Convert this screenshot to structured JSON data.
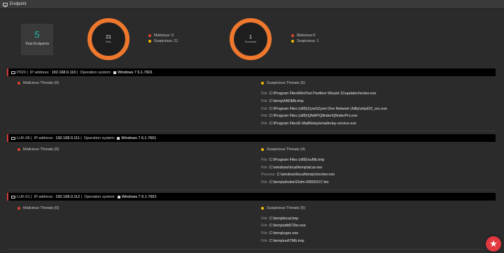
{
  "window": {
    "title": "Endpoint"
  },
  "summary": {
    "total_count": "5",
    "total_label": "Total Endpoints",
    "files": {
      "count": "21",
      "label": "Files",
      "malicious": "Malicious: 0",
      "suspicious": "Suspicious: 21"
    },
    "processes": {
      "count": "1",
      "label": "Processes",
      "malicious": "Malicious:0",
      "suspicious": "Suspicious: 1"
    }
  },
  "colors": {
    "accent_orange": "#f0782d",
    "malicious_red": "#e0452f",
    "suspicious_yellow": "#f5b800",
    "teal": "#22b8a3"
  },
  "endpoints": [
    {
      "name": "P920",
      "ip_label": "IP address:",
      "ip": "192.168.0.110",
      "os_label": "Operation system:",
      "os": "Windows 7 6.1.7601",
      "malicious_title": "Malicious Threats (0)",
      "suspicious_title": "Suspicious Threats (5)",
      "items": [
        {
          "kind": "File:",
          "path": "C:\\Program Files\\MiniTool Partition Wizard 11\\updatechecker.exe"
        },
        {
          "kind": "File:",
          "path": "C:\\temp\\ABDMb.tmp"
        },
        {
          "kind": "File:",
          "path": "C:\\Program Files (x86)\\Zyxel\\Zyxel One Network Utility\\zhpd32_svc.exe"
        },
        {
          "kind": "File:",
          "path": "C:\\Program Files (x86)\\QNAP\\Qfinder\\QfinderPro.exe"
        },
        {
          "kind": "File:",
          "path": "C:\\Program Files\\E-MailRelay\\emailrelay-service.exe"
        }
      ]
    },
    {
      "name": "LUK-06",
      "ip_label": "IP address:",
      "ip": "192.168.0.111",
      "os_label": "Operation system:",
      "os": "Windows 7 6.1.7601",
      "malicious_title": "Malicious Threats (0)",
      "suspicious_title": "Suspicious Threats (4)",
      "items": [
        {
          "kind": "File:",
          "path": "C:\\Program Files (x86)\\ouMb.tmp"
        },
        {
          "kind": "File:",
          "path": "C:\\windows\\local\\temp\\aicar.exe"
        },
        {
          "kind": "Process:",
          "path": "C:\\windows\\local\\temp\\checker.exe"
        },
        {
          "kind": "File:",
          "path": "C:\\temp\\afcdstc\\Dsfm-00000157.bin"
        }
      ]
    },
    {
      "name": "LUK-01",
      "ip_label": "IP address:",
      "ip": "192.168.0.112",
      "os_label": "Operation system:",
      "os": "Windows 7 6.1.7601",
      "malicious_title": "Malicious Threats (0)",
      "suspicious_title": "Suspicious Threats (5)",
      "items": [
        {
          "kind": "File:",
          "path": "C:\\temp\\local.tmp"
        },
        {
          "kind": "File:",
          "path": "C:\\temp\\afb872bx.exe"
        },
        {
          "kind": "File:",
          "path": "C:\\temp\\cgec.exe"
        },
        {
          "kind": "File:",
          "path": "C:\\temp\\ou67Mb.tmp"
        }
      ]
    }
  ]
}
